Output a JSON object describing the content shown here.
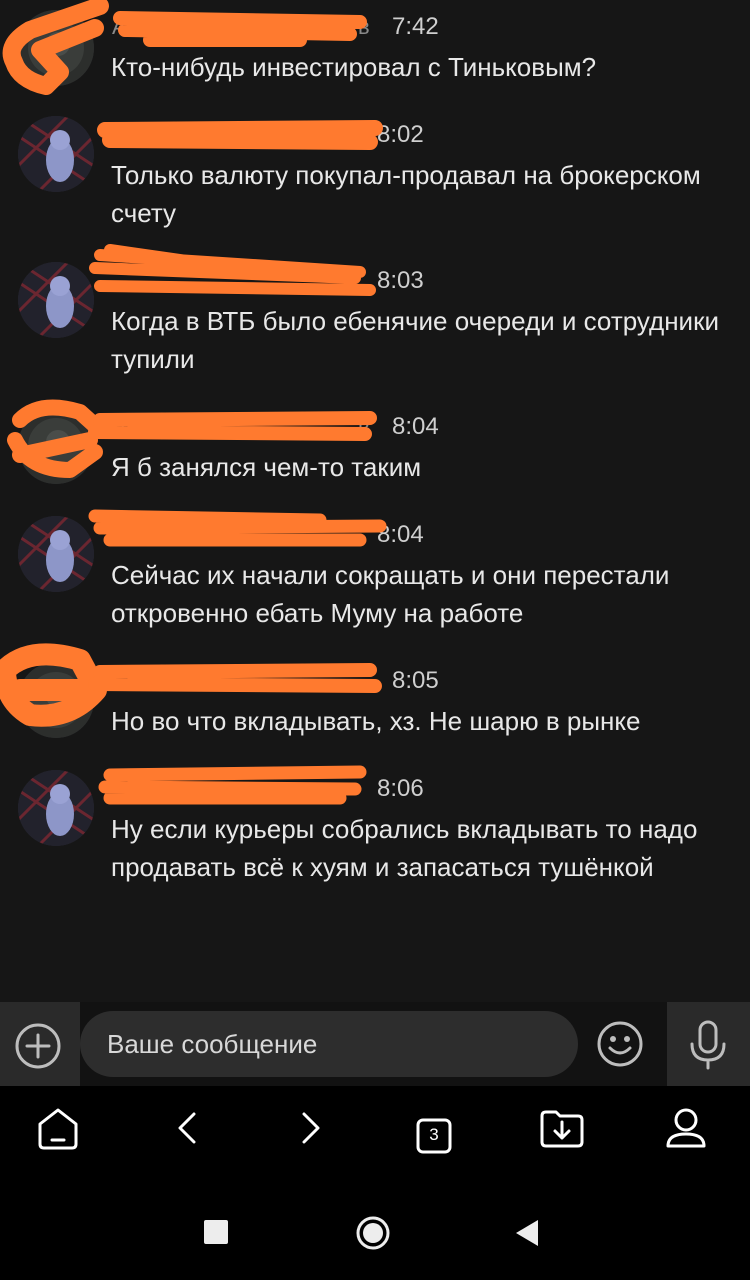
{
  "colors": {
    "background": "#161616",
    "redaction": "#ff7a2f",
    "text": "#e8e8e8",
    "timestamp": "#cfcfcf"
  },
  "messages": [
    {
      "sender": "А",
      "sender_suffix": "в",
      "time": "7:42",
      "text": "Кто-нибудь инвестировал с Тиньковым?",
      "avatar": "dark-photo-avatar"
    },
    {
      "sender": "А",
      "sender_suffix": "",
      "time": "8:02",
      "text": "Только валюту покупал-продавал на брокерском счету",
      "avatar": "owl-avatar"
    },
    {
      "sender": "",
      "sender_suffix": "",
      "time": "8:03",
      "text": "Когда в ВТБ было ебенячие очереди и сотрудники тупили",
      "avatar": "owl-avatar"
    },
    {
      "sender": "А",
      "sender_suffix": "в",
      "time": "8:04",
      "text": "Я б занялся чем-то таким",
      "avatar": "dark-photo-avatar"
    },
    {
      "sender": "",
      "sender_suffix": "",
      "time": "8:04",
      "text": "Сейчас их начали сокращать и они перестали откровенно ебать Муму на работе",
      "avatar": "owl-avatar"
    },
    {
      "sender": "",
      "sender_suffix": "",
      "time": "8:05",
      "text": "Но во что вкладывать, хз. Не шарю в рынке",
      "avatar": "dark-photo-avatar"
    },
    {
      "sender": "",
      "sender_suffix": "",
      "time": "8:06",
      "text": "Ну если курьеры собрались вкладывать то надо продавать всё к хуям и запасаться тушёнкой",
      "avatar": "owl-avatar"
    }
  ],
  "composer": {
    "placeholder": "Ваше сообщение",
    "attach_icon": "plus-circle-icon",
    "emoji_icon": "smiley-icon",
    "mic_icon": "microphone-icon"
  },
  "browser_nav": {
    "tab_count": "3",
    "icons": [
      "home-icon",
      "back-arrow-icon",
      "forward-arrow-icon",
      "tabs-icon",
      "downloads-folder-icon",
      "profile-icon"
    ]
  },
  "system_nav": {
    "icons": [
      "recents-square-icon",
      "home-circle-icon",
      "back-triangle-icon"
    ]
  }
}
